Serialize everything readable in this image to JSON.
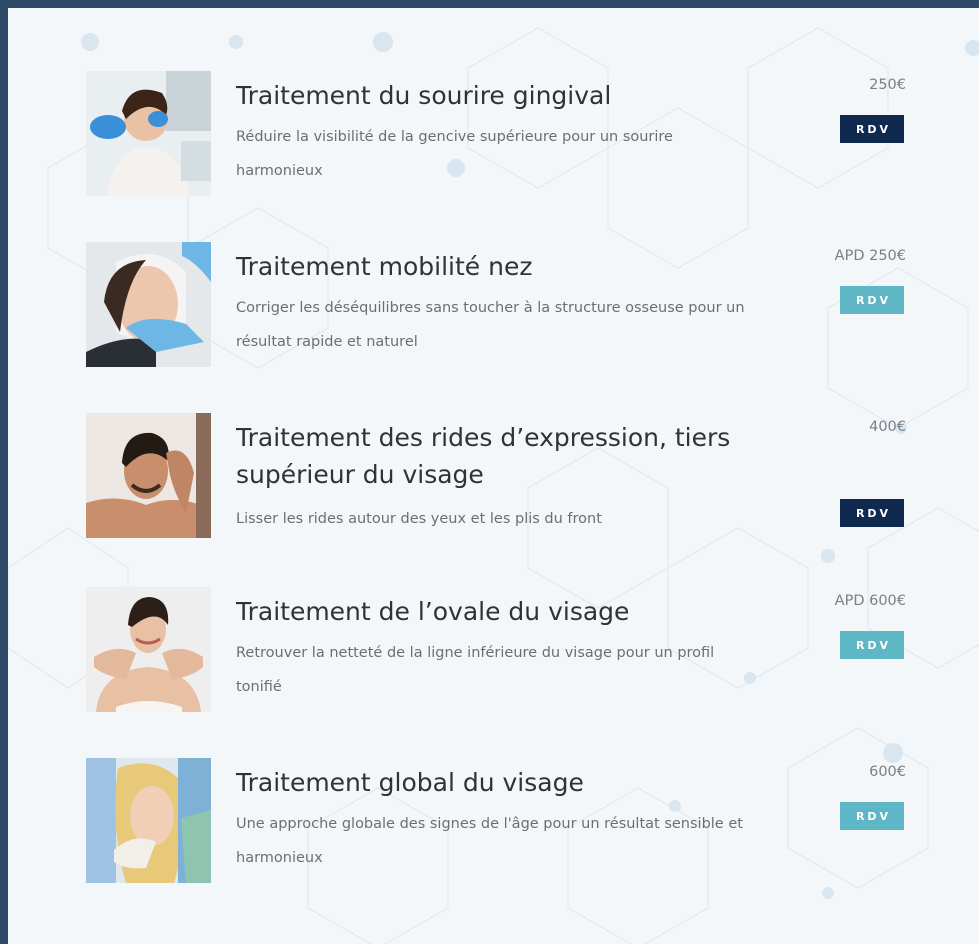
{
  "treatments": [
    {
      "title": "Traitement du sourire gingival",
      "description": "Réduire la visibilité de la gencive supérieure pour un sourire harmonieux",
      "price": "250€",
      "button": "RDV",
      "button_style": "dark",
      "image": "dental-smile-photo"
    },
    {
      "title": "Traitement mobilité nez",
      "description": "Corriger les déséquilibres sans toucher à la structure osseuse pour un résultat rapide et naturel",
      "price": "APD 250€",
      "button": "RDV",
      "button_style": "teal",
      "image": "nose-treatment-photo"
    },
    {
      "title": "Traitement des rides d’expression, tiers supérieur du visage",
      "description": "Lisser les rides autour des yeux et les plis du front",
      "price": "400€",
      "button": "RDV",
      "button_style": "dark",
      "image": "man-forehead-photo"
    },
    {
      "title": "Traitement de l’ovale du visage",
      "description": "Retrouver la netteté de la ligne inférieure du visage pour un profil tonifié",
      "price": "APD 600€",
      "button": "RDV",
      "button_style": "teal",
      "image": "woman-jawline-photo"
    },
    {
      "title": "Traitement global du visage",
      "description": "Une approche globale des signes de l'âge pour un résultat sensible et harmonieux",
      "price": "600€",
      "button": "RDV",
      "button_style": "teal",
      "image": "face-injection-photo"
    }
  ],
  "colors": {
    "frame": "#2f4a66",
    "background": "#f3f7fa",
    "dark_button": "#0f2a4e",
    "teal_button": "#5fb6c4"
  }
}
